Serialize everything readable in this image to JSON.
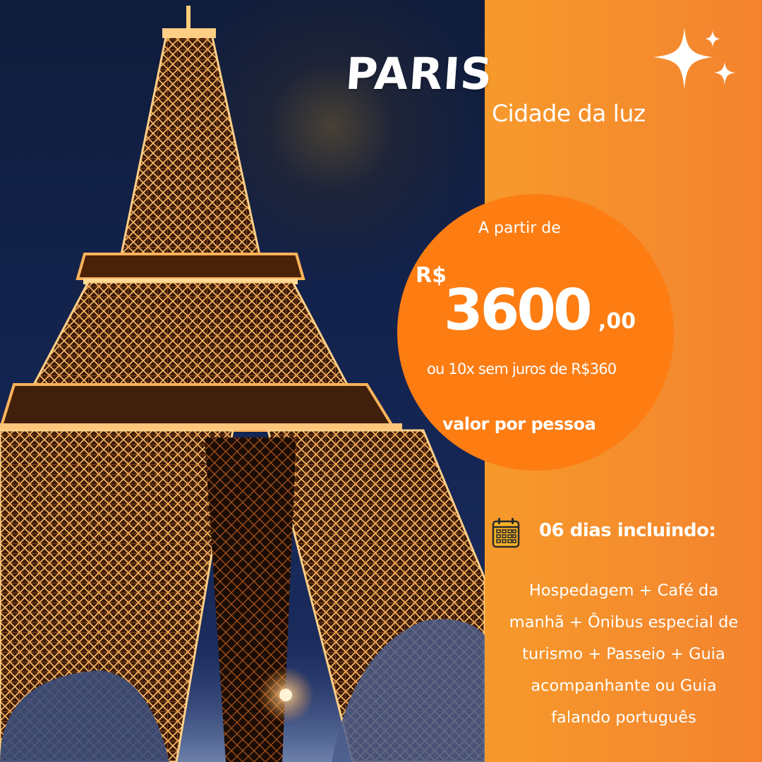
{
  "title": "PARIS",
  "subtitle": "Cidade da luz",
  "price": {
    "from_label": "A partir de",
    "currency": "R$",
    "amount": "3600",
    "cents": ",00",
    "installments": "ou 10x sem juros de R$360",
    "per_person": "valor  por pessoa"
  },
  "included": {
    "icon": "calendar-icon",
    "heading": "06 dias incluindo:",
    "lines": [
      "Hospedagem + Café da",
      "manhã +  Ônibus especial de",
      "turismo + Passeio + Guia",
      "acompanhante ou Guia",
      "falando português"
    ]
  },
  "photo": "Eiffel Tower illuminated at night",
  "colors": {
    "accent_circle": "#fd7d13",
    "gradient_start": "#f9c223",
    "gradient_end": "#f4832f",
    "night_sky": "#142552",
    "tower_light": "#ffb35a"
  }
}
